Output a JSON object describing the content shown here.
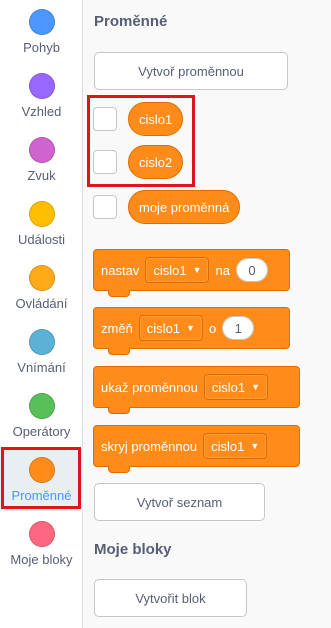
{
  "sidebar": {
    "categories": [
      {
        "label": "Pohyb",
        "color": "#4c97ff"
      },
      {
        "label": "Vzhled",
        "color": "#9966ff"
      },
      {
        "label": "Zvuk",
        "color": "#cf63cf"
      },
      {
        "label": "Události",
        "color": "#ffbf00"
      },
      {
        "label": "Ovládání",
        "color": "#ffab19"
      },
      {
        "label": "Vnímání",
        "color": "#5cb1d6"
      },
      {
        "label": "Operátory",
        "color": "#59c059"
      },
      {
        "label": "Proměnné",
        "color": "#ff8c1a"
      },
      {
        "label": "Moje bloky",
        "color": "#ff6680"
      }
    ],
    "selected": "Proměnné"
  },
  "palette": {
    "variables_title": "Proměnné",
    "make_variable_button": "Vytvoř proměnnou",
    "variables": [
      "cislo1",
      "cislo2",
      "moje proměnná"
    ],
    "blocks": {
      "set": {
        "label": "nastav",
        "dropdown": "cislo1",
        "connector": "na",
        "value": "0"
      },
      "change": {
        "label": "změň",
        "dropdown": "cislo1",
        "connector": "o",
        "value": "1"
      },
      "show": {
        "label": "ukaž proměnnou",
        "dropdown": "cislo1"
      },
      "hide": {
        "label": "skryj proměnnou",
        "dropdown": "cislo1"
      }
    },
    "make_list_button": "Vytvoř seznam",
    "my_blocks_title": "Moje bloky",
    "make_block_button": "Vytvořit blok"
  },
  "colors": {
    "variables_orange": "#ff8c1a",
    "highlight_red": "#e0141e"
  }
}
